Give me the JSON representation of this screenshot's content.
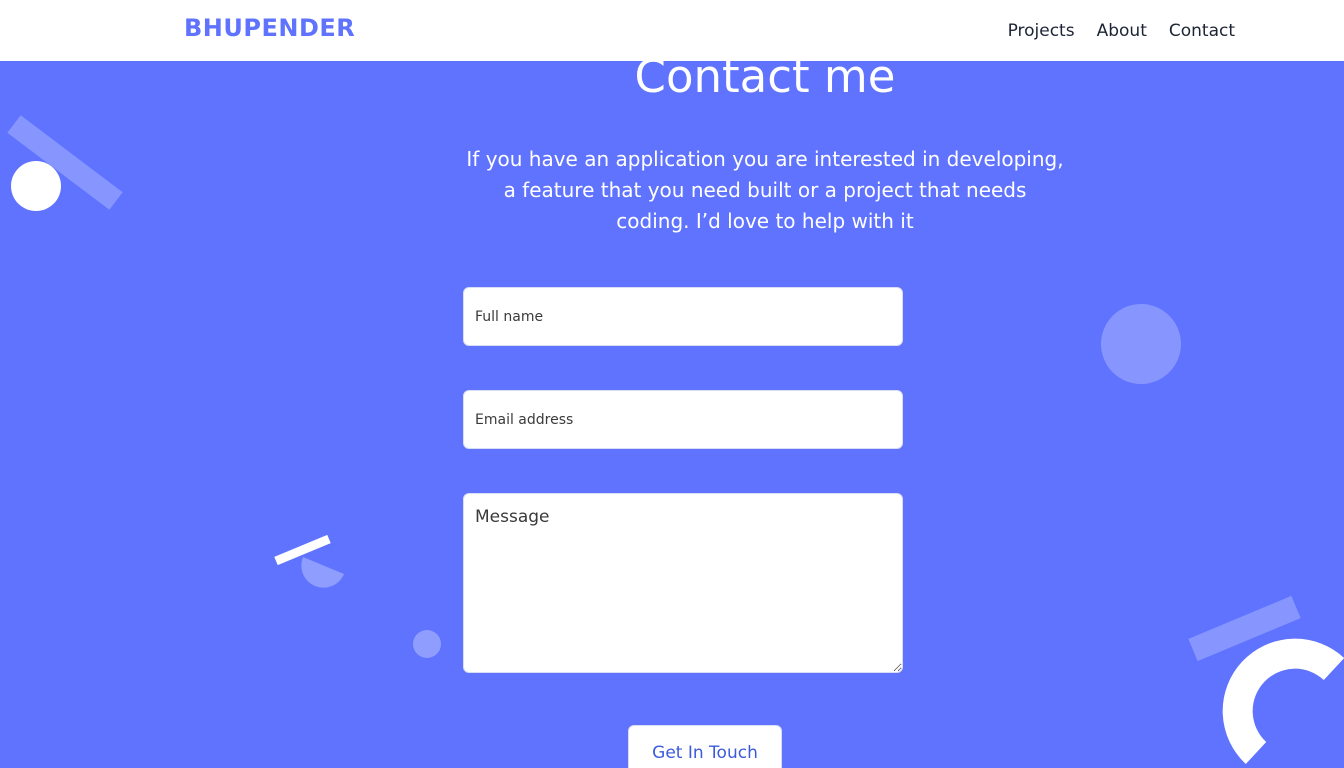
{
  "header": {
    "brand": "BHUPENDER",
    "nav": [
      {
        "label": "Projects"
      },
      {
        "label": "About"
      },
      {
        "label": "Contact"
      }
    ]
  },
  "contact": {
    "title": "Contact me",
    "intro": "If you have an application you are interested in developing, a feature that you need built or a project that needs coding. I’d love to help with it",
    "fields": {
      "name_placeholder": "Full name",
      "email_placeholder": "Email address",
      "message_placeholder": "Message"
    },
    "submit_label": "Get In Touch"
  },
  "colors": {
    "background": "#5f73ff",
    "brand": "#5f73ff",
    "nav_text": "#1c2435",
    "button_text": "#3b5bdb"
  }
}
